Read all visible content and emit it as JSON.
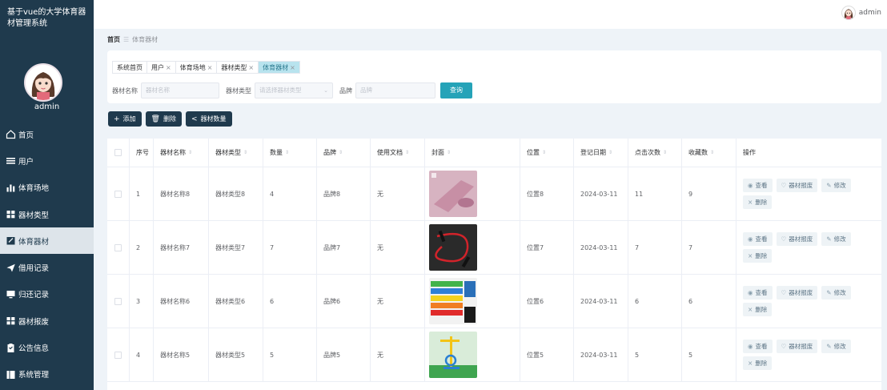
{
  "app": {
    "title": "基于vue的大学体育器材管理系统",
    "user": "admin"
  },
  "sidebar": {
    "items": [
      {
        "label": "首页",
        "icon": "home-icon"
      },
      {
        "label": "用户",
        "icon": "list-icon"
      },
      {
        "label": "体育场地",
        "icon": "bar-chart-icon"
      },
      {
        "label": "器材类型",
        "icon": "grid-icon"
      },
      {
        "label": "体育器材",
        "icon": "edit-icon",
        "active": true
      },
      {
        "label": "借用记录",
        "icon": "send-icon"
      },
      {
        "label": "归还记录",
        "icon": "monitor-icon"
      },
      {
        "label": "器材报废",
        "icon": "grid-icon"
      },
      {
        "label": "公告信息",
        "icon": "clipboard-icon"
      },
      {
        "label": "系统管理",
        "icon": "building-icon"
      }
    ]
  },
  "breadcrumb": {
    "home": "首页",
    "separator": "☰",
    "current": "体育器材"
  },
  "tabs": [
    {
      "label": "系统首页",
      "closable": false
    },
    {
      "label": "用户",
      "closable": true
    },
    {
      "label": "体育场地",
      "closable": true
    },
    {
      "label": "器材类型",
      "closable": true
    },
    {
      "label": "体育器材",
      "closable": true,
      "active": true
    }
  ],
  "search": {
    "name_label": "器材名称",
    "name_placeholder": "器材名称",
    "type_label": "器材类型",
    "type_placeholder": "请选择器材类型",
    "brand_label": "品牌",
    "brand_placeholder": "品牌",
    "query_button": "查询"
  },
  "actions": {
    "add": "添加",
    "delete": "删除",
    "count": "器材数量"
  },
  "table": {
    "headers": {
      "index": "序号",
      "name": "器材名称",
      "type": "器材类型",
      "qty": "数量",
      "brand": "品牌",
      "doc": "使用文档",
      "cover": "封面",
      "location": "位置",
      "date": "登记日期",
      "clicks": "点击次数",
      "favs": "收藏数",
      "ops": "操作"
    },
    "op_labels": {
      "view": "查看",
      "scrap": "器材报废",
      "edit": "修改",
      "delete": "删除"
    },
    "rows": [
      {
        "index": "1",
        "name": "器材名称8",
        "type": "器材类型8",
        "qty": "4",
        "brand": "品牌8",
        "doc": "无",
        "location": "位置8",
        "date": "2024-03-11",
        "clicks": "11",
        "favs": "9",
        "cover": "yoga-mat"
      },
      {
        "index": "2",
        "name": "器材名称7",
        "type": "器材类型7",
        "qty": "7",
        "brand": "品牌7",
        "doc": "无",
        "location": "位置7",
        "date": "2024-03-11",
        "clicks": "7",
        "favs": "7",
        "cover": "jump-rope"
      },
      {
        "index": "3",
        "name": "器材名称6",
        "type": "器材类型6",
        "qty": "6",
        "brand": "品牌6",
        "doc": "无",
        "location": "位置6",
        "date": "2024-03-11",
        "clicks": "6",
        "favs": "6",
        "cover": "resistance-bands"
      },
      {
        "index": "4",
        "name": "器材名称5",
        "type": "器材类型5",
        "qty": "5",
        "brand": "品牌5",
        "doc": "无",
        "location": "位置5",
        "date": "2024-03-11",
        "clicks": "5",
        "favs": "5",
        "cover": "outdoor-fitness-machine"
      }
    ]
  },
  "colors": {
    "sidebar": "#1f3a4d",
    "accent": "#25a3b8",
    "active_tab": "#b8e3ee"
  }
}
